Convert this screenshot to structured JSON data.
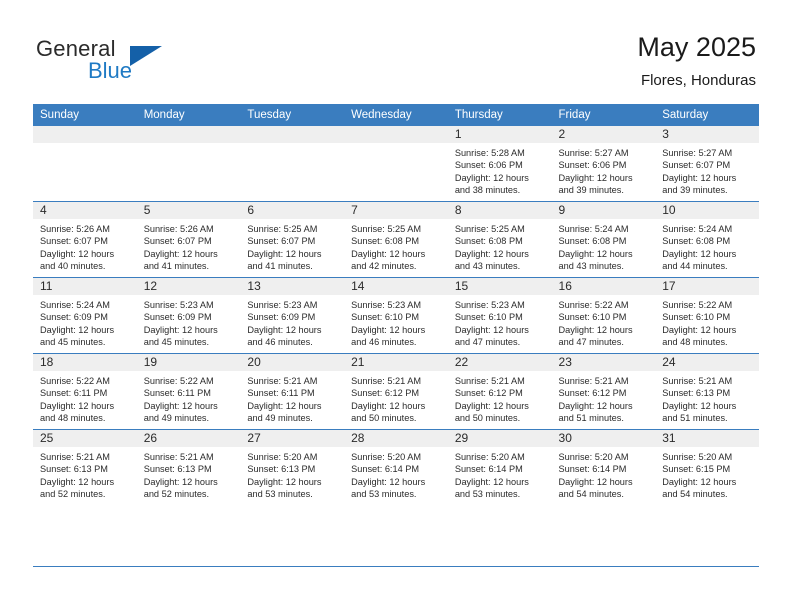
{
  "logo": {
    "word_one": "General",
    "word_two": "Blue",
    "icon": "triangle-mark",
    "color_dark": "#2b2b2b",
    "color_blue": "#1f7ac4"
  },
  "header": {
    "title": "May 2025",
    "subtitle": "Flores, Honduras"
  },
  "theme": {
    "header_blue": "#3a7dbf",
    "daynum_band": "#efefef",
    "text": "#2b2b2b"
  },
  "weekday_headers": [
    "Sunday",
    "Monday",
    "Tuesday",
    "Wednesday",
    "Thursday",
    "Friday",
    "Saturday"
  ],
  "labels": {
    "sunrise": "Sunrise:",
    "sunset": "Sunset:",
    "daylight": "Daylight:"
  },
  "weeks": [
    [
      {
        "day": "",
        "empty": true
      },
      {
        "day": "",
        "empty": true
      },
      {
        "day": "",
        "empty": true
      },
      {
        "day": "",
        "empty": true
      },
      {
        "day": "1",
        "sunrise": "Sunrise: 5:28 AM",
        "sunset": "Sunset: 6:06 PM",
        "daylight": "Daylight: 12 hours and 38 minutes."
      },
      {
        "day": "2",
        "sunrise": "Sunrise: 5:27 AM",
        "sunset": "Sunset: 6:06 PM",
        "daylight": "Daylight: 12 hours and 39 minutes."
      },
      {
        "day": "3",
        "sunrise": "Sunrise: 5:27 AM",
        "sunset": "Sunset: 6:07 PM",
        "daylight": "Daylight: 12 hours and 39 minutes."
      }
    ],
    [
      {
        "day": "4",
        "sunrise": "Sunrise: 5:26 AM",
        "sunset": "Sunset: 6:07 PM",
        "daylight": "Daylight: 12 hours and 40 minutes."
      },
      {
        "day": "5",
        "sunrise": "Sunrise: 5:26 AM",
        "sunset": "Sunset: 6:07 PM",
        "daylight": "Daylight: 12 hours and 41 minutes."
      },
      {
        "day": "6",
        "sunrise": "Sunrise: 5:25 AM",
        "sunset": "Sunset: 6:07 PM",
        "daylight": "Daylight: 12 hours and 41 minutes."
      },
      {
        "day": "7",
        "sunrise": "Sunrise: 5:25 AM",
        "sunset": "Sunset: 6:08 PM",
        "daylight": "Daylight: 12 hours and 42 minutes."
      },
      {
        "day": "8",
        "sunrise": "Sunrise: 5:25 AM",
        "sunset": "Sunset: 6:08 PM",
        "daylight": "Daylight: 12 hours and 43 minutes."
      },
      {
        "day": "9",
        "sunrise": "Sunrise: 5:24 AM",
        "sunset": "Sunset: 6:08 PM",
        "daylight": "Daylight: 12 hours and 43 minutes."
      },
      {
        "day": "10",
        "sunrise": "Sunrise: 5:24 AM",
        "sunset": "Sunset: 6:08 PM",
        "daylight": "Daylight: 12 hours and 44 minutes."
      }
    ],
    [
      {
        "day": "11",
        "sunrise": "Sunrise: 5:24 AM",
        "sunset": "Sunset: 6:09 PM",
        "daylight": "Daylight: 12 hours and 45 minutes."
      },
      {
        "day": "12",
        "sunrise": "Sunrise: 5:23 AM",
        "sunset": "Sunset: 6:09 PM",
        "daylight": "Daylight: 12 hours and 45 minutes."
      },
      {
        "day": "13",
        "sunrise": "Sunrise: 5:23 AM",
        "sunset": "Sunset: 6:09 PM",
        "daylight": "Daylight: 12 hours and 46 minutes."
      },
      {
        "day": "14",
        "sunrise": "Sunrise: 5:23 AM",
        "sunset": "Sunset: 6:10 PM",
        "daylight": "Daylight: 12 hours and 46 minutes."
      },
      {
        "day": "15",
        "sunrise": "Sunrise: 5:23 AM",
        "sunset": "Sunset: 6:10 PM",
        "daylight": "Daylight: 12 hours and 47 minutes."
      },
      {
        "day": "16",
        "sunrise": "Sunrise: 5:22 AM",
        "sunset": "Sunset: 6:10 PM",
        "daylight": "Daylight: 12 hours and 47 minutes."
      },
      {
        "day": "17",
        "sunrise": "Sunrise: 5:22 AM",
        "sunset": "Sunset: 6:10 PM",
        "daylight": "Daylight: 12 hours and 48 minutes."
      }
    ],
    [
      {
        "day": "18",
        "sunrise": "Sunrise: 5:22 AM",
        "sunset": "Sunset: 6:11 PM",
        "daylight": "Daylight: 12 hours and 48 minutes."
      },
      {
        "day": "19",
        "sunrise": "Sunrise: 5:22 AM",
        "sunset": "Sunset: 6:11 PM",
        "daylight": "Daylight: 12 hours and 49 minutes."
      },
      {
        "day": "20",
        "sunrise": "Sunrise: 5:21 AM",
        "sunset": "Sunset: 6:11 PM",
        "daylight": "Daylight: 12 hours and 49 minutes."
      },
      {
        "day": "21",
        "sunrise": "Sunrise: 5:21 AM",
        "sunset": "Sunset: 6:12 PM",
        "daylight": "Daylight: 12 hours and 50 minutes."
      },
      {
        "day": "22",
        "sunrise": "Sunrise: 5:21 AM",
        "sunset": "Sunset: 6:12 PM",
        "daylight": "Daylight: 12 hours and 50 minutes."
      },
      {
        "day": "23",
        "sunrise": "Sunrise: 5:21 AM",
        "sunset": "Sunset: 6:12 PM",
        "daylight": "Daylight: 12 hours and 51 minutes."
      },
      {
        "day": "24",
        "sunrise": "Sunrise: 5:21 AM",
        "sunset": "Sunset: 6:13 PM",
        "daylight": "Daylight: 12 hours and 51 minutes."
      }
    ],
    [
      {
        "day": "25",
        "sunrise": "Sunrise: 5:21 AM",
        "sunset": "Sunset: 6:13 PM",
        "daylight": "Daylight: 12 hours and 52 minutes."
      },
      {
        "day": "26",
        "sunrise": "Sunrise: 5:21 AM",
        "sunset": "Sunset: 6:13 PM",
        "daylight": "Daylight: 12 hours and 52 minutes."
      },
      {
        "day": "27",
        "sunrise": "Sunrise: 5:20 AM",
        "sunset": "Sunset: 6:13 PM",
        "daylight": "Daylight: 12 hours and 53 minutes."
      },
      {
        "day": "28",
        "sunrise": "Sunrise: 5:20 AM",
        "sunset": "Sunset: 6:14 PM",
        "daylight": "Daylight: 12 hours and 53 minutes."
      },
      {
        "day": "29",
        "sunrise": "Sunrise: 5:20 AM",
        "sunset": "Sunset: 6:14 PM",
        "daylight": "Daylight: 12 hours and 53 minutes."
      },
      {
        "day": "30",
        "sunrise": "Sunrise: 5:20 AM",
        "sunset": "Sunset: 6:14 PM",
        "daylight": "Daylight: 12 hours and 54 minutes."
      },
      {
        "day": "31",
        "sunrise": "Sunrise: 5:20 AM",
        "sunset": "Sunset: 6:15 PM",
        "daylight": "Daylight: 12 hours and 54 minutes."
      }
    ]
  ]
}
